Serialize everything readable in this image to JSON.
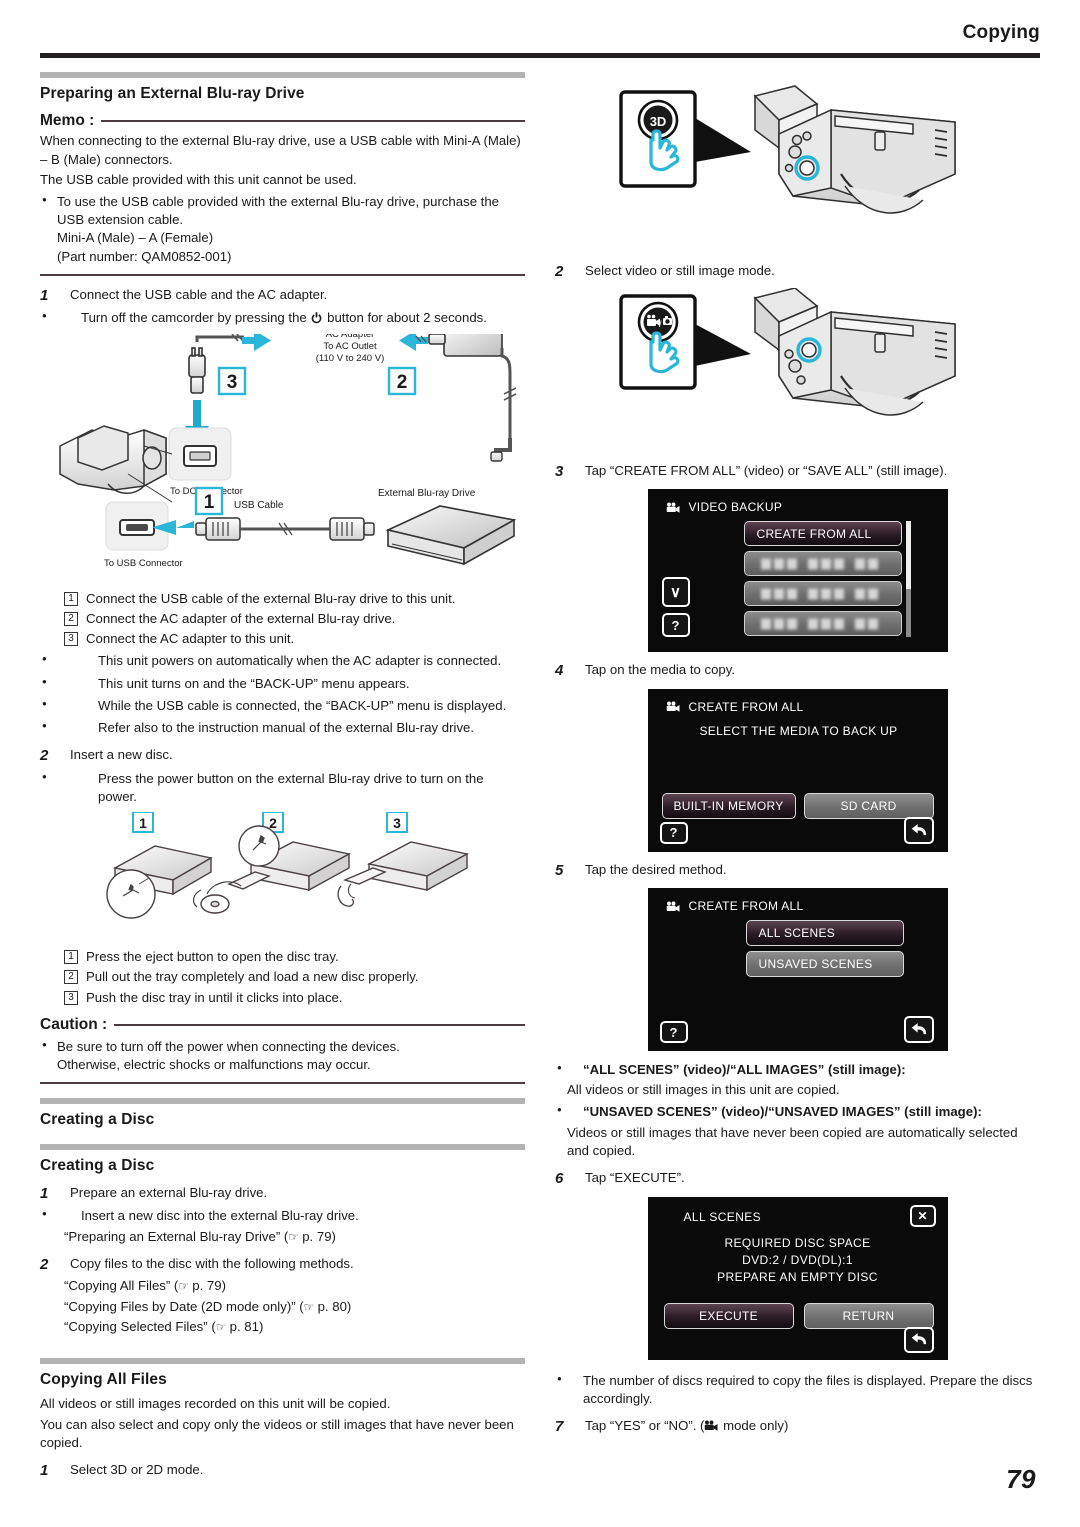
{
  "header": {
    "title": "Copying"
  },
  "footer": {
    "page_number": "79"
  },
  "left_column": {
    "section_title": "Preparing an External Blu-ray Drive",
    "memo_label": "Memo :",
    "memo_lines": [
      "When connecting to the external Blu-ray drive, use a USB cable with Mini-A (Male) – B (Male) connectors.",
      "The USB cable provided with this unit cannot be used."
    ],
    "memo_bullet": "To use the USB cable provided with the external Blu-ray drive, purchase the USB extension cable.",
    "memo_bullet_sub1": "Mini-A (Male) – A (Female)",
    "memo_bullet_sub2": "(Part number: QAM0852-001)",
    "step1": {
      "num": "1",
      "text": "Connect the USB cable and the AC adapter.",
      "bullet_pre": "Turn off the camcorder by pressing the",
      "bullet_post": "button for about 2 seconds."
    },
    "connection_figure": {
      "labels": {
        "ac_adapter_l1": "AC Adapter",
        "ac_adapter_l2": "To AC Outlet",
        "ac_adapter_l3": "(110 V to 240 V)",
        "to_dc_connector": "To DC Connector",
        "to_usb_connector": "To USB Connector",
        "usb_cable": "USB Cable",
        "external_drive": "External Blu-ray Drive",
        "callout_1": "1",
        "callout_2": "2",
        "callout_3": "3"
      }
    },
    "connect_steps": [
      {
        "num": "1",
        "text": "Connect the USB cable of the external Blu-ray drive to this unit."
      },
      {
        "num": "2",
        "text": "Connect the AC adapter of the external Blu-ray drive."
      },
      {
        "num": "3",
        "text": "Connect the AC adapter to this unit."
      }
    ],
    "connect_bullets": [
      "This unit powers on automatically when the AC adapter is connected.",
      "This unit turns on and the “BACK-UP” menu appears.",
      "While the USB cable is connected, the “BACK-UP” menu is displayed.",
      "Refer also to the instruction manual of the external Blu-ray drive."
    ],
    "step2": {
      "num": "2",
      "text": "Insert a new disc.",
      "bullet": "Press the power button on the external Blu-ray drive to turn on the power."
    },
    "disc_figure": {
      "callout_1": "1",
      "callout_2": "2",
      "callout_3": "3"
    },
    "disc_steps": [
      {
        "num": "1",
        "text": "Press the eject button to open the disc tray."
      },
      {
        "num": "2",
        "text": "Pull out the tray completely and load a new disc properly."
      },
      {
        "num": "3",
        "text": "Push the disc tray in until it clicks into place."
      }
    ],
    "caution_label": "Caution :",
    "caution_bullet_l1": "Be sure to turn off the power when connecting the devices.",
    "caution_bullet_l2": "Otherwise, electric shocks or malfunctions may occur.",
    "creating_disc_title": "Creating a Disc",
    "creating_disc_sub": "Creating a Disc",
    "cd_step1": {
      "num": "1",
      "text": "Prepare an external Blu-ray drive.",
      "bullet": "Insert a new disc into the external Blu-ray drive.",
      "ref": "“Preparing an External Blu-ray Drive” (",
      "ref_page": " p. 79)"
    },
    "cd_step2": {
      "num": "2",
      "text": "Copy files to the disc with the following methods.",
      "refs": [
        {
          "label": "“Copying All Files” (",
          "page": " p. 79)"
        },
        {
          "label": "“Copying Files by Date (2D mode only)” (",
          "page": " p. 80)"
        },
        {
          "label": "“Copying Selected Files” (",
          "page": " p. 81)"
        }
      ]
    },
    "copying_all_title": "Copying All Files",
    "copying_all_lines": [
      "All videos or still images recorded on this unit will be copied.",
      "You can also select and copy only the videos or still images that have never been copied."
    ],
    "ca_step1": {
      "num": "1",
      "text": "Select 3D or 2D mode."
    }
  },
  "right_column": {
    "figure_3d": {
      "button_label": "3D"
    },
    "step2": {
      "num": "2",
      "text": "Select video or still image mode."
    },
    "figure_mode": {
      "button_label": " / "
    },
    "step3": {
      "num": "3",
      "text": "Tap “CREATE FROM ALL” (video) or “SAVE ALL” (still image)."
    },
    "screen_video_backup": {
      "title": "VIDEO BACKUP",
      "selected_item": "CREATE FROM ALL",
      "blurred_rows": 3,
      "down_arrow": "∨",
      "help_key": "?"
    },
    "step4": {
      "num": "4",
      "text": "Tap on the media to copy."
    },
    "screen_select_media": {
      "title": "CREATE FROM ALL",
      "subtitle": "SELECT THE MEDIA TO BACK UP",
      "button_builtin": "BUILT-IN MEMORY",
      "button_sd": "SD CARD",
      "help_key": "?",
      "back_key": "↩"
    },
    "step5": {
      "num": "5",
      "text": "Tap the desired method."
    },
    "screen_method": {
      "title": "CREATE FROM ALL",
      "button_all": "ALL SCENES",
      "button_unsaved": "UNSAVED SCENES",
      "help_key": "?",
      "back_key": "↩"
    },
    "method_notes": [
      {
        "bold": "“ALL SCENES” (video)/“ALL IMAGES” (still image):",
        "body": "All videos or still images in this unit are copied."
      },
      {
        "bold": "“UNSAVED SCENES” (video)/“UNSAVED IMAGES” (still image):",
        "body": "Videos or still images that have never been copied are automatically selected and copied."
      }
    ],
    "step6": {
      "num": "6",
      "text": "Tap “EXECUTE”."
    },
    "screen_execute": {
      "title": "ALL SCENES",
      "close_key": "✕",
      "line1": "REQUIRED DISC SPACE",
      "line2": "DVD:2 / DVD(DL):1",
      "line3": "PREPARE AN EMPTY DISC",
      "button_execute": "EXECUTE",
      "button_return": "RETURN",
      "back_key": "↩"
    },
    "execute_bullet": "The number of discs required to copy the files is displayed. Prepare the discs accordingly.",
    "step7": {
      "num": "7",
      "text_pre": "Tap “YES” or “NO”. (",
      "text_post": " mode only)"
    }
  }
}
